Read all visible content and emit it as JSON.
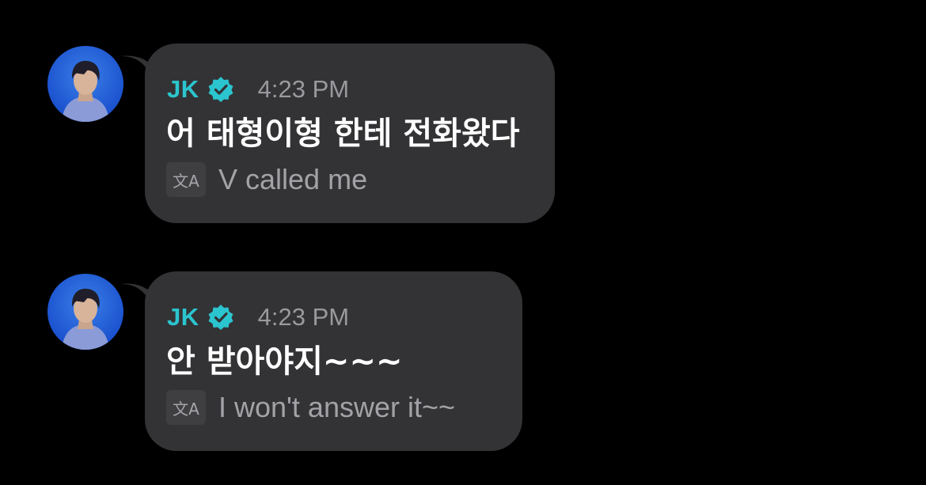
{
  "colors": {
    "background": "#000000",
    "bubble": "#333335",
    "sender": "#2bc5cf",
    "verified_badge": "#2bc5cf",
    "time": "#9a9a9e",
    "message_text": "#ffffff",
    "translation_text": "#a3a3a7"
  },
  "messages": [
    {
      "sender": "JK",
      "verified": true,
      "time": "4:23 PM",
      "text": "어 태형이형 한테 전화왔다",
      "translate_icon": "文A",
      "translation": "V called me"
    },
    {
      "sender": "JK",
      "verified": true,
      "time": "4:23 PM",
      "text": "안 받아야지~~~",
      "translate_icon": "文A",
      "translation": "I won't answer it~~"
    }
  ]
}
